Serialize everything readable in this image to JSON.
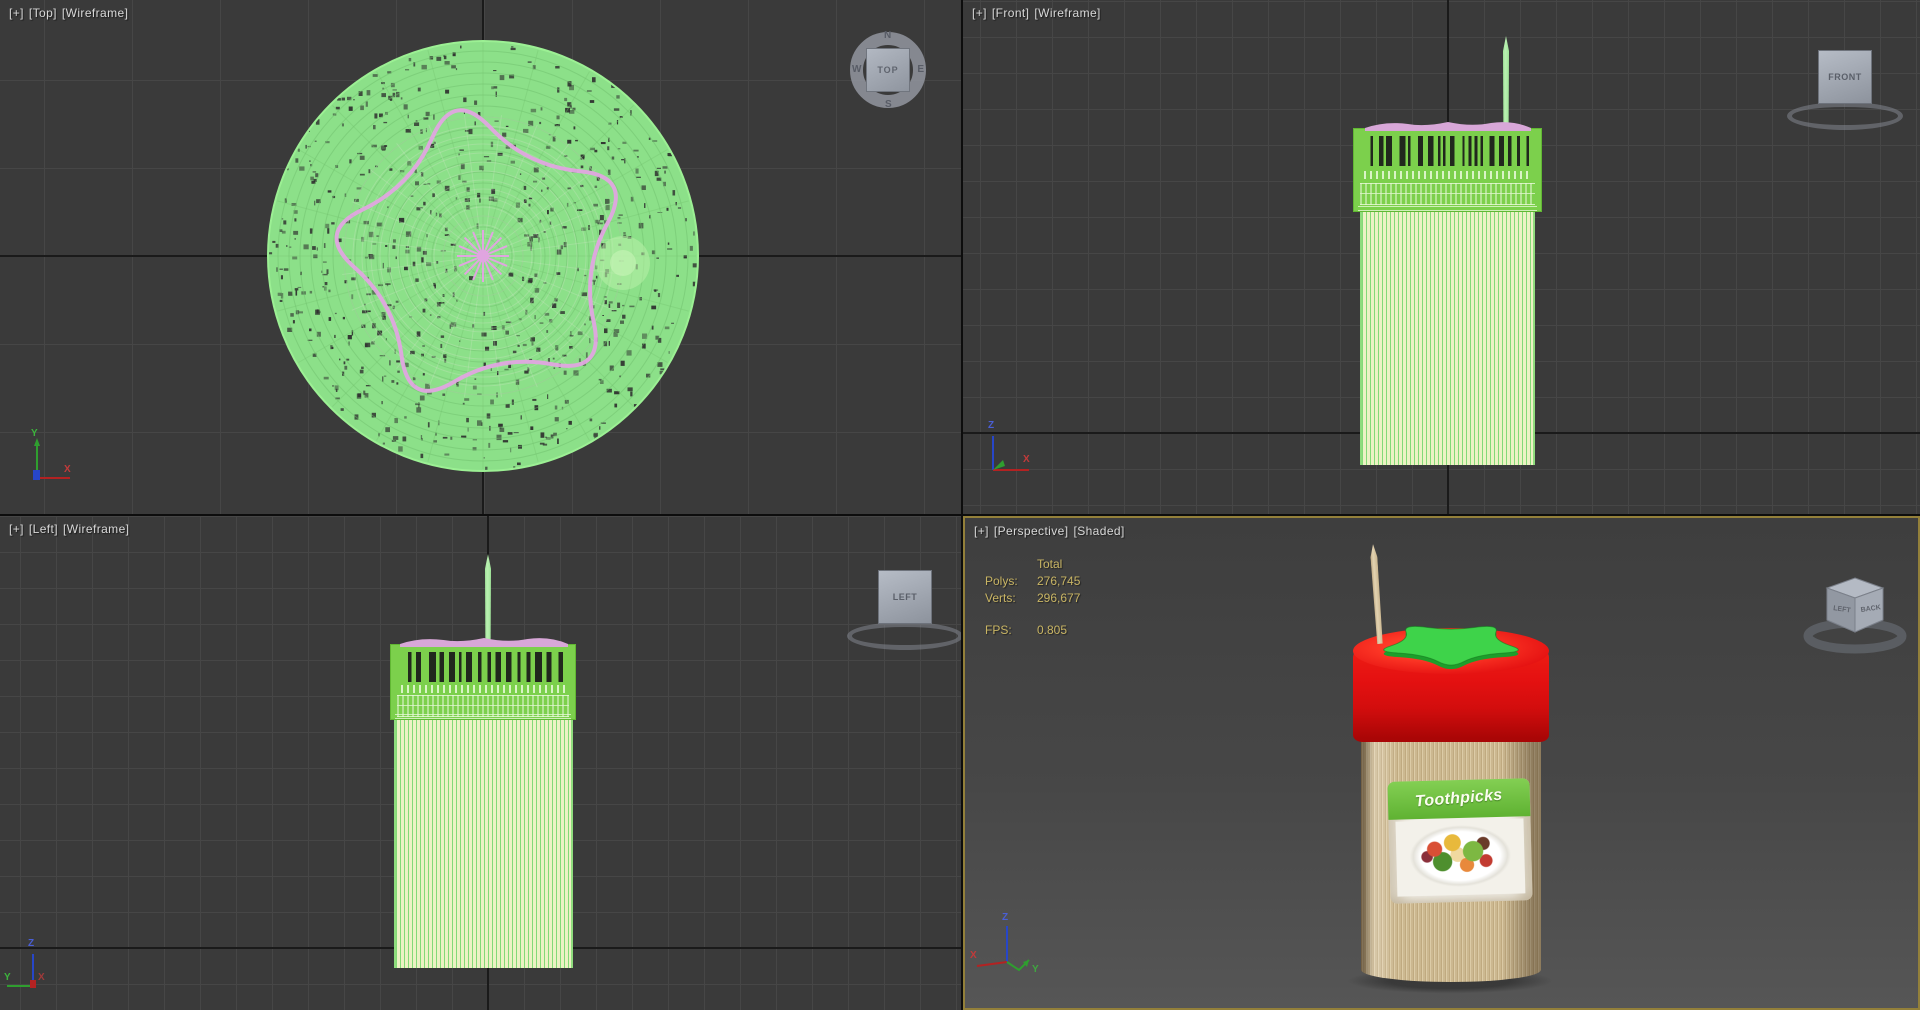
{
  "viewports": {
    "top": {
      "menu_label": "[+]",
      "view_label": "[Top]",
      "shading_label": "[Wireframe]",
      "viewcube_face": "TOP",
      "compass": {
        "north": "N",
        "south": "S",
        "east": "E",
        "west": "W"
      },
      "axes": {
        "vertical": "Y",
        "horizontal": "X"
      }
    },
    "front": {
      "menu_label": "[+]",
      "view_label": "[Front]",
      "shading_label": "[Wireframe]",
      "viewcube_face": "FRONT",
      "axes": {
        "vertical": "Z",
        "horizontal": "X"
      }
    },
    "left": {
      "menu_label": "[+]",
      "view_label": "[Left]",
      "shading_label": "[Wireframe]",
      "viewcube_face": "LEFT",
      "axes": {
        "vertical": "Z",
        "horizontal": "Y",
        "depth": "X"
      }
    },
    "perspective": {
      "menu_label": "[+]",
      "view_label": "[Perspective]",
      "shading_label": "[Shaded]",
      "viewcube_faces": {
        "left": "LEFT",
        "right": "BACK"
      },
      "axes": {
        "vertical": "Z",
        "left": "X",
        "right": "Y"
      },
      "stats": {
        "total_header": "Total",
        "polys_label": "Polys:",
        "polys_value": "276,745",
        "verts_label": "Verts:",
        "verts_value": "296,677",
        "fps_label": "FPS:",
        "fps_value": "0.805"
      }
    }
  },
  "scene": {
    "product_label_text": "Toothpicks"
  },
  "colors": {
    "wire_green": "#8ce089",
    "selection_pink": "#e0a5e0",
    "cap_green": "#7cd04c",
    "cap_red": "#e51111",
    "star_green": "#3ed34a",
    "stats_yellow": "#c9b564",
    "active_border": "#93803a",
    "grid_bg": "#3a3a3a",
    "grid_line": "#464646"
  }
}
